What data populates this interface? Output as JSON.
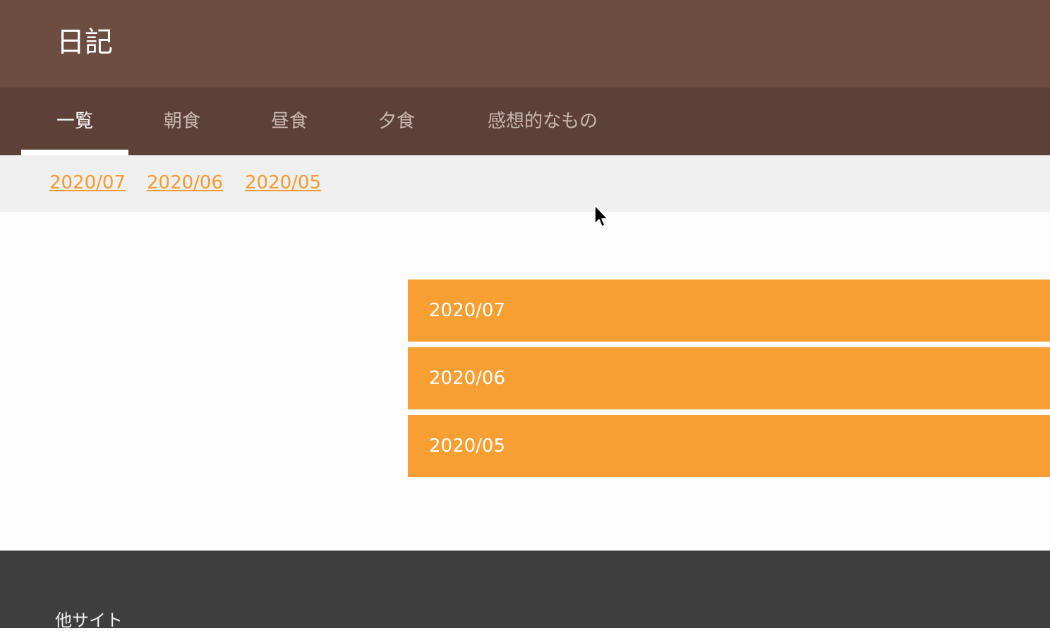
{
  "header": {
    "title": "日記"
  },
  "tabs": [
    {
      "label": "一覧",
      "active": true
    },
    {
      "label": "朝食",
      "active": false
    },
    {
      "label": "昼食",
      "active": false
    },
    {
      "label": "夕食",
      "active": false
    },
    {
      "label": "感想的なもの",
      "active": false
    }
  ],
  "month_nav": {
    "links": [
      "2020/07",
      "2020/06",
      "2020/05"
    ]
  },
  "months": {
    "cards": [
      "2020/07",
      "2020/06",
      "2020/05"
    ]
  },
  "footer": {
    "heading": "他サイト"
  },
  "colors": {
    "header": "#6d4c41",
    "tab_bar": "#5d4037",
    "accent": "#f89f33",
    "footer": "#3e3e3e"
  },
  "icons": {
    "cursor": "mouse-pointer-icon"
  }
}
